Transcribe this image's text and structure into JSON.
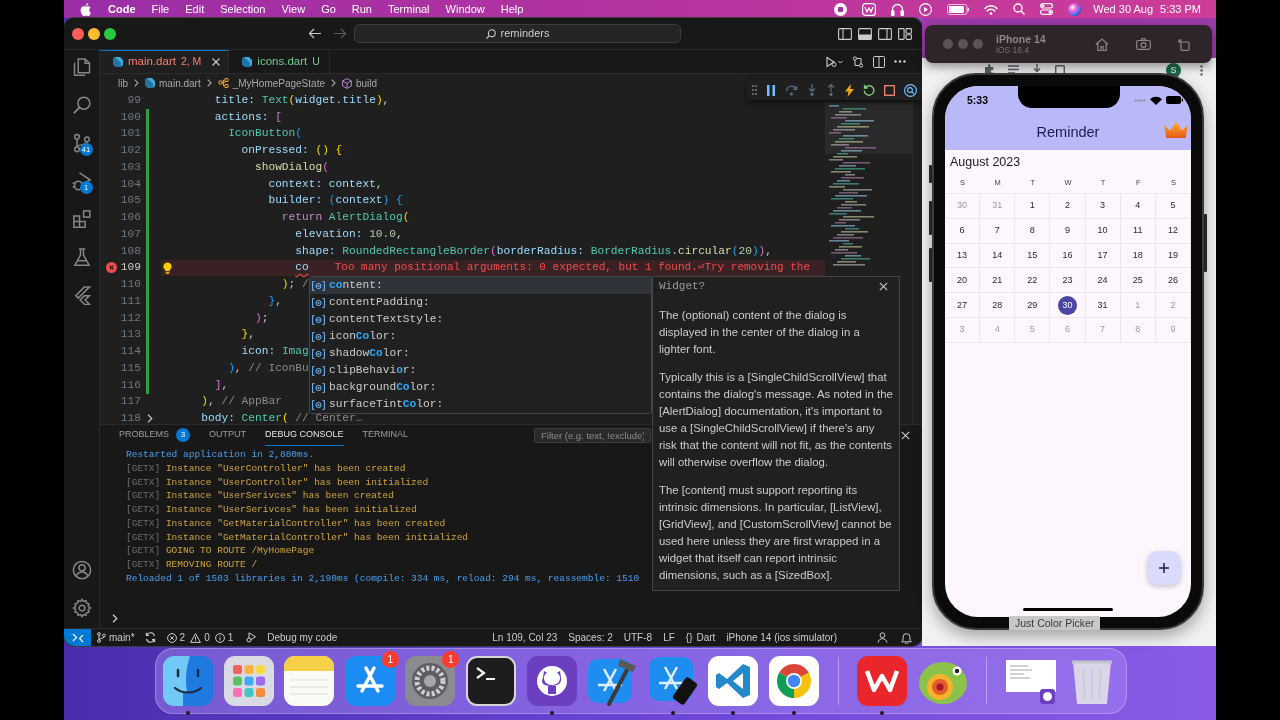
{
  "menu_bar": {
    "app": "Code",
    "menus": [
      "File",
      "Edit",
      "Selection",
      "View",
      "Go",
      "Run",
      "Terminal",
      "Window",
      "Help"
    ],
    "date": "Wed 30 Aug",
    "time": "5:33 PM"
  },
  "editor_window": {
    "command_center": "reminders",
    "activity_bar": {
      "top": [
        {
          "kind": "explorer"
        },
        {
          "kind": "search"
        },
        {
          "kind": "source_control",
          "badge": "41"
        },
        {
          "kind": "run_debug",
          "badge": "1"
        },
        {
          "kind": "extensions"
        },
        {
          "kind": "testing"
        },
        {
          "kind": "flutter"
        }
      ],
      "bottom": [
        {
          "kind": "accounts"
        },
        {
          "kind": "settings"
        }
      ]
    },
    "tabs": [
      {
        "label": "main.dart",
        "status": "2, M",
        "color": "#f88070",
        "selected": true
      },
      {
        "label": "icons.dart",
        "status": "U",
        "color": "#73c991",
        "selected": false
      }
    ],
    "breadcrumb": [
      {
        "kind": "folder",
        "label": "lib"
      },
      {
        "kind": "file",
        "label": "main.dart"
      },
      {
        "kind": "class",
        "label": "_MyHomePageState"
      },
      {
        "kind": "method",
        "label": "build"
      }
    ],
    "code_lines": [
      {
        "number": "99",
        "modified": false,
        "error": false,
        "current": false,
        "folded": false,
        "tokens": [
          {
            "text": "        title: ",
            "kind": "property"
          },
          {
            "text": "Text",
            "kind": "type"
          },
          {
            "text": "(",
            "kind": "bracket1"
          },
          {
            "text": "widget.title",
            "kind": "property"
          },
          {
            "text": ")",
            "kind": "bracket1"
          },
          {
            "text": ",",
            "kind": "punctuation"
          }
        ]
      },
      {
        "number": "100",
        "modified": true,
        "error": false,
        "current": false,
        "folded": false,
        "tokens": [
          {
            "text": "        actions: ",
            "kind": "property"
          },
          {
            "text": "[",
            "kind": "bracket2"
          }
        ]
      },
      {
        "number": "101",
        "modified": true,
        "error": false,
        "current": false,
        "folded": false,
        "tokens": [
          {
            "text": "          IconButton",
            "kind": "type"
          },
          {
            "text": "(",
            "kind": "bracket3"
          }
        ]
      },
      {
        "number": "102",
        "modified": true,
        "error": false,
        "current": false,
        "folded": false,
        "tokens": [
          {
            "text": "            onPressed: ",
            "kind": "property"
          },
          {
            "text": "() {",
            "kind": "bracket1"
          }
        ]
      },
      {
        "number": "103",
        "modified": true,
        "error": false,
        "current": false,
        "folded": false,
        "tokens": [
          {
            "text": "              showDialog",
            "kind": "function"
          },
          {
            "text": "(",
            "kind": "bracket2"
          }
        ]
      },
      {
        "number": "104",
        "modified": true,
        "error": false,
        "current": false,
        "folded": false,
        "tokens": [
          {
            "text": "                context: context",
            "kind": "property"
          },
          {
            "text": ",",
            "kind": "punctuation"
          }
        ]
      },
      {
        "number": "105",
        "modified": true,
        "error": false,
        "current": false,
        "folded": false,
        "tokens": [
          {
            "text": "                builder: ",
            "kind": "property"
          },
          {
            "text": "(",
            "kind": "bracket3"
          },
          {
            "text": "context",
            "kind": "property"
          },
          {
            "text": ") {",
            "kind": "bracket3"
          }
        ]
      },
      {
        "number": "106",
        "modified": true,
        "error": false,
        "current": false,
        "folded": false,
        "tokens": [
          {
            "text": "                  return ",
            "kind": "keyword"
          },
          {
            "text": "AlertDialog",
            "kind": "type"
          },
          {
            "text": "(",
            "kind": "bracket1"
          }
        ]
      },
      {
        "number": "107",
        "modified": true,
        "error": false,
        "current": false,
        "folded": false,
        "tokens": [
          {
            "text": "                    elevation: ",
            "kind": "property"
          },
          {
            "text": "10.0",
            "kind": "number"
          },
          {
            "text": ",",
            "kind": "punctuation"
          }
        ]
      },
      {
        "number": "108",
        "modified": true,
        "error": false,
        "current": false,
        "folded": false,
        "tokens": [
          {
            "text": "                    shape: ",
            "kind": "property"
          },
          {
            "text": "RoundedRectangleBorder",
            "kind": "type"
          },
          {
            "text": "(",
            "kind": "bracket2"
          },
          {
            "text": "borderRadius: ",
            "kind": "property"
          },
          {
            "text": "BorderRadius",
            "kind": "type"
          },
          {
            "text": ".",
            "kind": "punctuation"
          },
          {
            "text": "circular",
            "kind": "function"
          },
          {
            "text": "(",
            "kind": "bracket3"
          },
          {
            "text": "20",
            "kind": "number"
          },
          {
            "text": ")",
            "kind": "bracket3"
          },
          {
            "text": ")",
            "kind": "bracket2"
          },
          {
            "text": ",",
            "kind": "punctuation"
          }
        ]
      },
      {
        "number": "109",
        "modified": true,
        "error": true,
        "current": true,
        "folded": false,
        "tokens": [
          {
            "text": "                    co",
            "kind": "property"
          }
        ],
        "diagnostic": "Too many positional arguments: 0 expected, but 1 found.⏎Try removing the"
      },
      {
        "number": "110",
        "modified": true,
        "error": false,
        "current": false,
        "folded": false,
        "tokens": [
          {
            "text": "                  )",
            "kind": "bracket1"
          },
          {
            "text": ";",
            "kind": "punctuation"
          },
          {
            "text": " /",
            "kind": "label"
          }
        ]
      },
      {
        "number": "111",
        "modified": true,
        "error": false,
        "current": false,
        "folded": false,
        "tokens": [
          {
            "text": "                }",
            "kind": "bracket3"
          },
          {
            "text": ",",
            "kind": "punctuation"
          }
        ]
      },
      {
        "number": "112",
        "modified": true,
        "error": false,
        "current": false,
        "folded": false,
        "tokens": [
          {
            "text": "              )",
            "kind": "bracket2"
          },
          {
            "text": ";",
            "kind": "punctuation"
          }
        ]
      },
      {
        "number": "113",
        "modified": true,
        "error": false,
        "current": false,
        "folded": false,
        "tokens": [
          {
            "text": "            }",
            "kind": "bracket1"
          },
          {
            "text": ",",
            "kind": "punctuation"
          }
        ]
      },
      {
        "number": "114",
        "modified": true,
        "error": false,
        "current": false,
        "folded": false,
        "tokens": [
          {
            "text": "            icon: ",
            "kind": "property"
          },
          {
            "text": "Imag",
            "kind": "type"
          }
        ]
      },
      {
        "number": "115",
        "modified": true,
        "error": false,
        "current": false,
        "folded": false,
        "tokens": [
          {
            "text": "          )",
            "kind": "bracket3"
          },
          {
            "text": ", ",
            "kind": "punctuation"
          },
          {
            "text": "// IconBu",
            "kind": "label"
          }
        ]
      },
      {
        "number": "116",
        "modified": true,
        "error": false,
        "current": false,
        "folded": false,
        "tokens": [
          {
            "text": "        ]",
            "kind": "bracket2"
          },
          {
            "text": ",",
            "kind": "punctuation"
          }
        ]
      },
      {
        "number": "117",
        "modified": false,
        "error": false,
        "current": false,
        "folded": false,
        "tokens": [
          {
            "text": "      )",
            "kind": "bracket1"
          },
          {
            "text": ", ",
            "kind": "punctuation"
          },
          {
            "text": "// AppBar",
            "kind": "label"
          }
        ]
      },
      {
        "number": "118",
        "modified": false,
        "error": false,
        "current": false,
        "folded": true,
        "tokens": [
          {
            "text": "      body: ",
            "kind": "property"
          },
          {
            "text": "Center",
            "kind": "type"
          },
          {
            "text": "(",
            "kind": "bracket1"
          },
          {
            "text": " // Center…",
            "kind": "label"
          }
        ]
      }
    ],
    "suggestions": [
      {
        "label": "**co**ntent:",
        "selected": true
      },
      {
        "label": "contentPadding:",
        "selected": false
      },
      {
        "label": "contentTextStyle:",
        "selected": false
      },
      {
        "label": "icon**Co**lor:",
        "selected": false
      },
      {
        "label": "shadow**Co**lor:",
        "selected": false
      },
      {
        "label": "clipBehavi**o**r:",
        "selected": false
      },
      {
        "label": "background**Co**lor:",
        "selected": false
      },
      {
        "label": "surfaceTint**Co**lor:",
        "selected": false
      }
    ],
    "suggestion_details": {
      "signature": "Widget?",
      "paragraphs": [
        "The (optional) content of the dialog is displayed in the center of the dialog in a lighter font.",
        "Typically this is a [SingleChildScrollView] that contains the dialog's message. As noted in the [AlertDialog] documentation, it's important to use a [SingleChildScrollView] if there's any risk that the content will not fit, as the contents will otherwise overflow the dialog.",
        "The [content] must support reporting its intrinsic dimensions. In particular, [ListView], [GridView], and [CustomScrollView] cannot be used here unless they are first wrapped in a widget that itself can report intrinsic dimensions, such as a [SizedBox]."
      ]
    },
    "panel": {
      "tabs": [
        {
          "label": "PROBLEMS",
          "badge": "3",
          "selected": false
        },
        {
          "label": "OUTPUT",
          "selected": false
        },
        {
          "label": "DEBUG CONSOLE",
          "selected": true
        },
        {
          "label": "TERMINAL",
          "selected": false
        }
      ],
      "filter": {
        "placeholder": "Filter (e.g. text, !exclude)"
      },
      "console": [
        {
          "kind": "info",
          "text": "Restarted application in 2,880ms."
        },
        {
          "kind": "log",
          "tag": "[GETX]",
          "text": "Instance \"UserController\" has been created"
        },
        {
          "kind": "log",
          "tag": "[GETX]",
          "text": "Instance \"UserController\" has been initialized"
        },
        {
          "kind": "log",
          "tag": "[GETX]",
          "text": "Instance \"UserSerivces\" has been created"
        },
        {
          "kind": "log",
          "tag": "[GETX]",
          "text": "Instance \"UserSerivces\" has been initialized"
        },
        {
          "kind": "log",
          "tag": "[GETX]",
          "text": "Instance \"GetMaterialController\" has been created"
        },
        {
          "kind": "log",
          "tag": "[GETX]",
          "text": "Instance \"GetMaterialController\" has been initialized"
        },
        {
          "kind": "log",
          "tag": "[GETX]",
          "text": "GOING TO ROUTE /MyHomePage"
        },
        {
          "kind": "log",
          "tag": "[GETX]",
          "text": "REMOVING ROUTE /"
        },
        {
          "kind": "info",
          "text": "Reloaded 1 of 1503 libraries in 2,190ms (compile: 334 ms, reload: 294 ms, reassemble: 1510"
        }
      ]
    },
    "status_bar": {
      "branch": "main*",
      "errors": "2",
      "warnings": "0",
      "infos": "1",
      "launch_config": "Debug my code",
      "cursor_position": "Ln 109, Col 23",
      "indentation": "Spaces: 2",
      "encoding": "UTF-8",
      "line_ending": "LF",
      "language_symbol": "{}",
      "language": "Dart",
      "device": "iPhone 14 (ios simulator)"
    }
  },
  "simulator": {
    "device": "iPhone 14",
    "os": "iOS 16.4",
    "phone_time": "5:33",
    "app": {
      "title": "Reminder",
      "month": "August 2023",
      "weekdays": [
        "S",
        "M",
        "T",
        "W",
        "T",
        "F",
        "S"
      ],
      "weeks": [
        [
          {
            "day": "30",
            "in_month": false,
            "selected": false
          },
          {
            "day": "31",
            "in_month": false,
            "selected": false
          },
          {
            "day": "1",
            "in_month": true,
            "selected": false
          },
          {
            "day": "2",
            "in_month": true,
            "selected": false
          },
          {
            "day": "3",
            "in_month": true,
            "selected": false
          },
          {
            "day": "4",
            "in_month": true,
            "selected": false
          },
          {
            "day": "5",
            "in_month": true,
            "selected": false
          }
        ],
        [
          {
            "day": "6",
            "in_month": true,
            "selected": false
          },
          {
            "day": "7",
            "in_month": true,
            "selected": false
          },
          {
            "day": "8",
            "in_month": true,
            "selected": false
          },
          {
            "day": "9",
            "in_month": true,
            "selected": false
          },
          {
            "day": "10",
            "in_month": true,
            "selected": false
          },
          {
            "day": "11",
            "in_month": true,
            "selected": false
          },
          {
            "day": "12",
            "in_month": true,
            "selected": false
          }
        ],
        [
          {
            "day": "13",
            "in_month": true,
            "selected": false
          },
          {
            "day": "14",
            "in_month": true,
            "selected": false
          },
          {
            "day": "15",
            "in_month": true,
            "selected": false
          },
          {
            "day": "16",
            "in_month": true,
            "selected": false
          },
          {
            "day": "17",
            "in_month": true,
            "selected": false
          },
          {
            "day": "18",
            "in_month": true,
            "selected": false
          },
          {
            "day": "19",
            "in_month": true,
            "selected": false
          }
        ],
        [
          {
            "day": "20",
            "in_month": true,
            "selected": false
          },
          {
            "day": "21",
            "in_month": true,
            "selected": false
          },
          {
            "day": "22",
            "in_month": true,
            "selected": false
          },
          {
            "day": "23",
            "in_month": true,
            "selected": false
          },
          {
            "day": "24",
            "in_month": true,
            "selected": false
          },
          {
            "day": "25",
            "in_month": true,
            "selected": false
          },
          {
            "day": "26",
            "in_month": true,
            "selected": false
          }
        ],
        [
          {
            "day": "27",
            "in_month": true,
            "selected": false
          },
          {
            "day": "28",
            "in_month": true,
            "selected": false
          },
          {
            "day": "29",
            "in_month": true,
            "selected": false
          },
          {
            "day": "30",
            "in_month": true,
            "selected": true
          },
          {
            "day": "31",
            "in_month": true,
            "selected": false
          },
          {
            "day": "1",
            "in_month": false,
            "selected": false
          },
          {
            "day": "2",
            "in_month": false,
            "selected": false
          }
        ],
        [
          {
            "day": "3",
            "in_month": false,
            "selected": false
          },
          {
            "day": "4",
            "in_month": false,
            "selected": false
          },
          {
            "day": "5",
            "in_month": false,
            "selected": false
          },
          {
            "day": "6",
            "in_month": false,
            "selected": false
          },
          {
            "day": "7",
            "in_month": false,
            "selected": false
          },
          {
            "day": "8",
            "in_month": false,
            "selected": false
          },
          {
            "day": "9",
            "in_month": false,
            "selected": false
          }
        ]
      ]
    }
  },
  "desktop": {
    "browser_avatar": "S",
    "window_label": "Just Color Picker"
  },
  "dock": [
    {
      "kind": "finder",
      "running": true
    },
    {
      "kind": "launchpad",
      "running": false
    },
    {
      "kind": "notes",
      "running": false
    },
    {
      "kind": "app_store",
      "running": false,
      "badge": "1"
    },
    {
      "kind": "system_settings",
      "running": false,
      "badge": "1"
    },
    {
      "kind": "terminal",
      "running": false
    },
    {
      "kind": "github_desktop",
      "running": true
    },
    {
      "kind": "xcode",
      "running": false
    },
    {
      "kind": "simulator",
      "running": true
    },
    {
      "kind": "vscode",
      "running": true
    },
    {
      "kind": "chrome",
      "running": true
    },
    {
      "kind": "separator"
    },
    {
      "kind": "wps",
      "running": true
    },
    {
      "kind": "chameleon",
      "running": false
    },
    {
      "kind": "separator"
    },
    {
      "kind": "window_thumbnail",
      "running": false
    },
    {
      "kind": "trash",
      "running": false
    }
  ]
}
